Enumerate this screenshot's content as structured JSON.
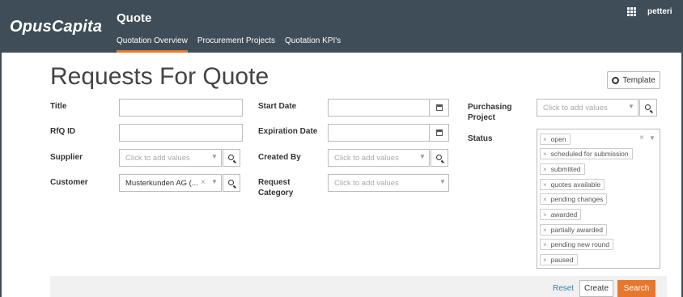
{
  "header": {
    "logo": "OpusCapita",
    "app_title": "Quote",
    "tabs": [
      {
        "label": "Quotation Overview",
        "active": true
      },
      {
        "label": "Procurement Projects",
        "active": false
      },
      {
        "label": "Quotation KPI's",
        "active": false
      }
    ],
    "user": "petteri",
    "grid_icon": "apps-grid-icon"
  },
  "page": {
    "title": "Requests For Quote",
    "template_button": "Template"
  },
  "form": {
    "title_label": "Title",
    "rfq_id_label": "RfQ ID",
    "supplier_label": "Supplier",
    "supplier_placeholder": "Click to add values",
    "customer_label": "Customer",
    "customer_value": "Musterkunden AG (...",
    "start_date_label": "Start Date",
    "expiration_date_label": "Expiration Date",
    "created_by_label": "Created By",
    "created_by_placeholder": "Click to add values",
    "request_category_label_1": "Request",
    "request_category_label_2": "Category",
    "request_category_placeholder": "Click to add values",
    "purchasing_project_label_1": "Purchasing",
    "purchasing_project_label_2": "Project",
    "purchasing_project_placeholder": "Click to add values",
    "status_label": "Status",
    "status_values": [
      "open",
      "scheduled for submission",
      "submitted",
      "quotes available",
      "pending changes",
      "awarded",
      "partially awarded",
      "pending new round",
      "paused"
    ]
  },
  "footer": {
    "reset": "Reset",
    "create": "Create",
    "search": "Search"
  },
  "colors": {
    "header_bg": "#3f4d58",
    "accent": "#e8772e",
    "link": "#3d7fa6"
  }
}
